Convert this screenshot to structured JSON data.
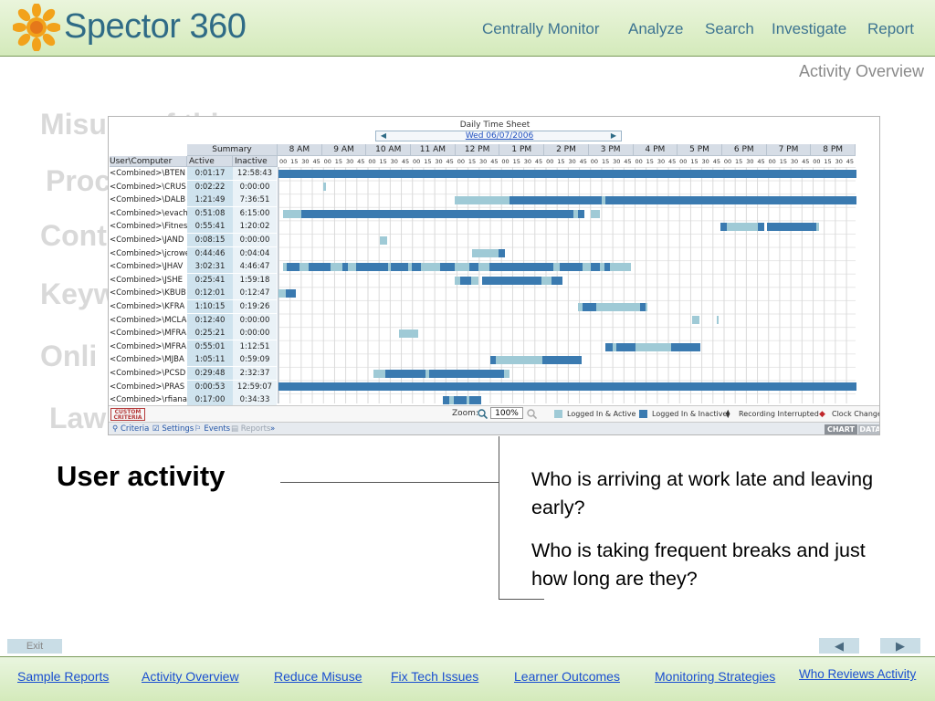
{
  "header": {
    "brand": "Spector 360",
    "nav": [
      "Centrally Monitor",
      "Analyze",
      "Search",
      "Investigate",
      "Report"
    ],
    "page_label": "Activity Overview"
  },
  "background_headings": [
    "Misuse of this...",
    "Proc",
    "Cont",
    "Keyw",
    "Onli",
    "Law"
  ],
  "screenshot": {
    "title": "Daily Time Sheet",
    "date": "Wed 06/07/2006",
    "summary_header": "Summary",
    "col_user": "User\\Computer",
    "col_active": "Active",
    "col_inactive": "Inactive",
    "hours": [
      "8 AM",
      "9 AM",
      "10 AM",
      "11 AM",
      "12 PM",
      "1 PM",
      "2 PM",
      "3 PM",
      "4 PM",
      "5 PM",
      "6 PM",
      "7 PM",
      "8 PM"
    ],
    "quarters": [
      "00",
      "15",
      "30",
      "45"
    ],
    "rows": [
      {
        "user": "<Combined>\\BTEN",
        "active": "0:01:17",
        "inactive": "12:58:43",
        "bars": [
          [
            0,
            100,
            "dark"
          ]
        ]
      },
      {
        "user": "<Combined>\\CRUS",
        "active": "0:02:22",
        "inactive": "0:00:00",
        "bars": [
          [
            7.8,
            8.2,
            "light"
          ]
        ]
      },
      {
        "user": "<Combined>\\DALB",
        "active": "1:21:49",
        "inactive": "7:36:51",
        "bars": [
          [
            30.5,
            40,
            "light"
          ],
          [
            40,
            43.5,
            "dark"
          ],
          [
            43.5,
            56,
            "dark"
          ],
          [
            56,
            56.6,
            "light"
          ],
          [
            56.6,
            100,
            "dark"
          ]
        ]
      },
      {
        "user": "<Combined>\\evach",
        "active": "0:51:08",
        "inactive": "6:15:00",
        "bars": [
          [
            0.8,
            4,
            "light"
          ],
          [
            4,
            24.5,
            "dark"
          ],
          [
            24.5,
            51,
            "dark"
          ],
          [
            51,
            51.8,
            "light"
          ],
          [
            51.8,
            53,
            "dark"
          ],
          [
            54,
            55.6,
            "light"
          ]
        ]
      },
      {
        "user": "<Combined>\\Fitnes",
        "active": "0:55:41",
        "inactive": "1:20:02",
        "bars": [
          [
            76.5,
            77.5,
            "dark"
          ],
          [
            77.5,
            83,
            "light"
          ],
          [
            83,
            84,
            "dark"
          ],
          [
            84.5,
            93,
            "dark"
          ],
          [
            93,
            93.5,
            "light"
          ]
        ]
      },
      {
        "user": "<Combined>\\JAND",
        "active": "0:08:15",
        "inactive": "0:00:00",
        "bars": [
          [
            17.6,
            18.8,
            "light"
          ]
        ]
      },
      {
        "user": "<Combined>\\jcrowe",
        "active": "0:44:46",
        "inactive": "0:04:04",
        "bars": [
          [
            33.5,
            38,
            "light"
          ],
          [
            38,
            39.2,
            "dark"
          ]
        ]
      },
      {
        "user": "<Combined>\\JHAV",
        "active": "3:02:31",
        "inactive": "4:46:47",
        "bars": [
          [
            0.8,
            1.4,
            "light"
          ],
          [
            1.4,
            3.6,
            "dark"
          ],
          [
            3.6,
            5.2,
            "light"
          ],
          [
            5.2,
            9,
            "dark"
          ],
          [
            9,
            11,
            "light"
          ],
          [
            11,
            12,
            "dark"
          ],
          [
            12,
            13.4,
            "light"
          ],
          [
            13.4,
            19,
            "dark"
          ],
          [
            19,
            19.5,
            "light"
          ],
          [
            19.5,
            22.4,
            "dark"
          ],
          [
            22.4,
            23,
            "light"
          ],
          [
            23,
            24.6,
            "dark"
          ],
          [
            24.6,
            28,
            "light"
          ],
          [
            28,
            30.5,
            "dark"
          ],
          [
            30.5,
            33,
            "light"
          ],
          [
            33,
            34.6,
            "dark"
          ],
          [
            34.6,
            36.5,
            "light"
          ],
          [
            36.5,
            47.5,
            "dark"
          ],
          [
            47.5,
            48.6,
            "light"
          ],
          [
            48.6,
            52.6,
            "dark"
          ],
          [
            52.6,
            54,
            "light"
          ],
          [
            54,
            55.6,
            "dark"
          ],
          [
            55.6,
            56.4,
            "light"
          ],
          [
            56.4,
            57.4,
            "dark"
          ],
          [
            57.4,
            61,
            "light"
          ]
        ]
      },
      {
        "user": "<Combined>\\JSHE",
        "active": "0:25:41",
        "inactive": "1:59:18",
        "bars": [
          [
            30.5,
            31.5,
            "light"
          ],
          [
            31.5,
            33.3,
            "dark"
          ],
          [
            33.3,
            34.6,
            "light"
          ],
          [
            35.2,
            45.5,
            "dark"
          ],
          [
            45.5,
            47.3,
            "light"
          ],
          [
            47.3,
            49.2,
            "dark"
          ]
        ]
      },
      {
        "user": "<Combined>\\KBUB",
        "active": "0:12:01",
        "inactive": "0:12:47",
        "bars": [
          [
            0,
            1.2,
            "light"
          ],
          [
            1.2,
            3,
            "dark"
          ]
        ]
      },
      {
        "user": "<Combined>\\KFRA",
        "active": "1:10:15",
        "inactive": "0:19:26",
        "bars": [
          [
            51.8,
            52.6,
            "light"
          ],
          [
            52.6,
            55,
            "dark"
          ],
          [
            55,
            62.5,
            "light"
          ],
          [
            62.5,
            63.5,
            "dark"
          ],
          [
            63.5,
            63.9,
            "light"
          ]
        ]
      },
      {
        "user": "<Combined>\\MCLA",
        "active": "0:12:40",
        "inactive": "0:00:00",
        "bars": [
          [
            71.5,
            72.8,
            "light"
          ],
          [
            75.8,
            76.1,
            "light"
          ]
        ]
      },
      {
        "user": "<Combined>\\MFRA",
        "active": "0:25:21",
        "inactive": "0:00:00",
        "bars": [
          [
            20.8,
            24.2,
            "light"
          ]
        ]
      },
      {
        "user": "<Combined>\\MFRA",
        "active": "0:55:01",
        "inactive": "1:12:51",
        "bars": [
          [
            56.5,
            57.8,
            "dark"
          ],
          [
            57.8,
            58.4,
            "light"
          ],
          [
            58.4,
            61.8,
            "dark"
          ],
          [
            61.8,
            68,
            "light"
          ],
          [
            68,
            73,
            "dark"
          ]
        ]
      },
      {
        "user": "<Combined>\\MJBA",
        "active": "1:05:11",
        "inactive": "0:59:09",
        "bars": [
          [
            36.6,
            37.6,
            "dark"
          ],
          [
            37.6,
            45.6,
            "light"
          ],
          [
            45.6,
            52.5,
            "dark"
          ]
        ]
      },
      {
        "user": "<Combined>\\PCSD",
        "active": "0:29:48",
        "inactive": "2:32:37",
        "bars": [
          [
            16.5,
            18.5,
            "light"
          ],
          [
            18.5,
            20.2,
            "dark"
          ],
          [
            20.2,
            25.5,
            "dark"
          ],
          [
            25.5,
            26,
            "light"
          ],
          [
            26,
            39,
            "dark"
          ],
          [
            39,
            40,
            "light"
          ]
        ]
      },
      {
        "user": "<Combined>\\PRAS",
        "active": "0:00:53",
        "inactive": "12:59:07",
        "bars": [
          [
            0,
            100,
            "dark"
          ]
        ]
      },
      {
        "user": "<Combined>\\rfiana",
        "active": "0:17:00",
        "inactive": "0:34:33",
        "bars": [
          [
            28.5,
            29.6,
            "dark"
          ],
          [
            29.6,
            30.4,
            "light"
          ],
          [
            30.4,
            32.6,
            "dark"
          ],
          [
            32.6,
            33,
            "light"
          ],
          [
            33,
            35,
            "dark"
          ]
        ]
      }
    ],
    "custom_criteria": "CUSTOM CRITERIA",
    "zoom_label": "Zoom:",
    "zoom_value": "100%",
    "legend": {
      "logged_active": "Logged In & Active",
      "logged_inactive": "Logged In & Inactive",
      "rec_interrupted": "Recording Interrupted",
      "clock_change": "Clock Change"
    },
    "tabs": [
      "Criteria",
      "Settings",
      "Events",
      "Reports",
      "»"
    ],
    "chart_tab": "CHART",
    "data_tab": "DATA",
    "colors": {
      "active": "#9fcad6",
      "inactive": "#3a7ab0"
    }
  },
  "main": {
    "title": "User activity",
    "q1": "Who is arriving at work late and leaving early?",
    "q2": "Who is taking frequent breaks and just how long are they?"
  },
  "controls": {
    "exit": "Exit",
    "prev": "◀",
    "next": "▶"
  },
  "footer": {
    "links": [
      "Sample Reports",
      "Activity Overview",
      "Reduce Misuse",
      "Fix Tech Issues",
      "Learner Outcomes",
      "Monitoring Strategies",
      "Who Reviews Activity"
    ]
  }
}
